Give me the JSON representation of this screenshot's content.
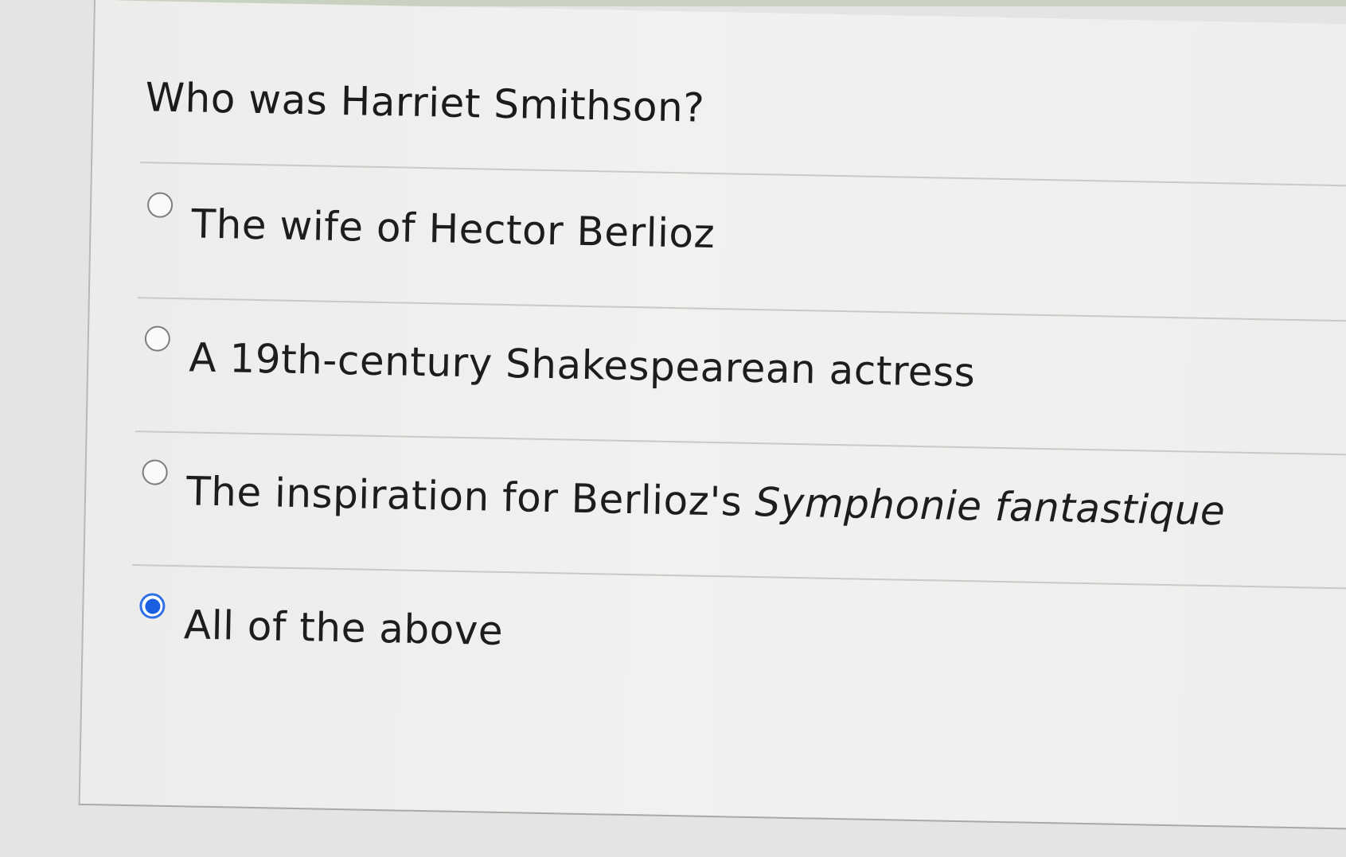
{
  "question": {
    "text": "Who was Harriet Smithson?"
  },
  "options": [
    {
      "label": "The wife of Hector Berlioz",
      "selected": false
    },
    {
      "label": "A 19th-century Shakespearean actress",
      "selected": false
    },
    {
      "label_prefix": "The inspiration for Berlioz's ",
      "label_italic": "Symphonie fantastique",
      "selected": false
    },
    {
      "label": "All of the above",
      "selected": true
    }
  ],
  "colors": {
    "selected_radio": "#1a5fe0",
    "page_background": "#efefed"
  }
}
